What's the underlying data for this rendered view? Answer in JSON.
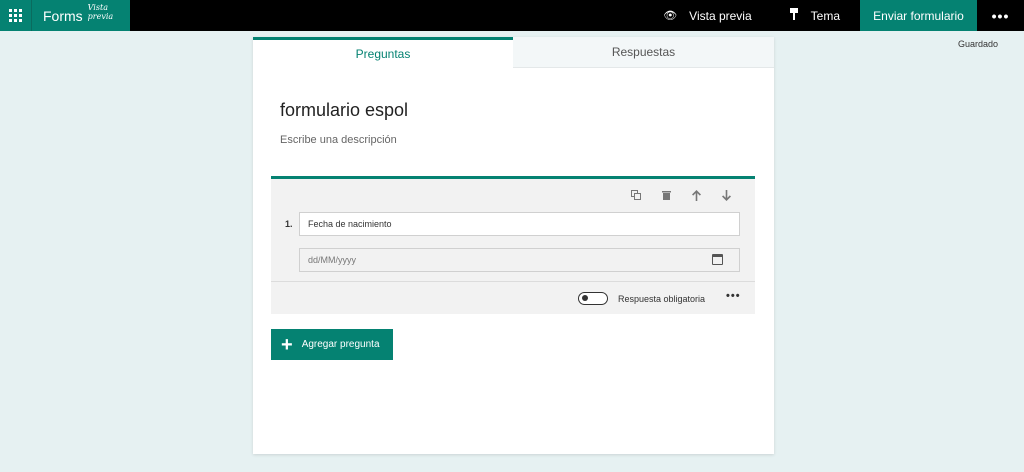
{
  "app": {
    "name": "Forms",
    "mode_label": "Vista previa"
  },
  "topbar": {
    "preview_label": "Vista previa",
    "theme_label": "Tema",
    "send_label": "Enviar formulario",
    "more_label": "•••"
  },
  "status": {
    "saved": "Guardado"
  },
  "tabs": [
    {
      "label": "Preguntas",
      "active": true
    },
    {
      "label": "Respuestas",
      "active": false
    }
  ],
  "form": {
    "title": "formulario espol",
    "description": "Escribe una descripción"
  },
  "question": {
    "number": "1.",
    "text": "Fecha de nacimiento",
    "date_placeholder": "dd/MM/yyyy",
    "required_label": "Respuesta obligatoria",
    "required": false,
    "more_label": "•••",
    "tools": [
      "copy-icon",
      "delete-icon",
      "arrow-up-icon",
      "arrow-down-icon"
    ]
  },
  "add_question": {
    "plus": "+",
    "label": "Agregar pregunta"
  },
  "colors": {
    "accent": "#058272",
    "background": "#e6f1f2",
    "topbar": "#000000"
  }
}
